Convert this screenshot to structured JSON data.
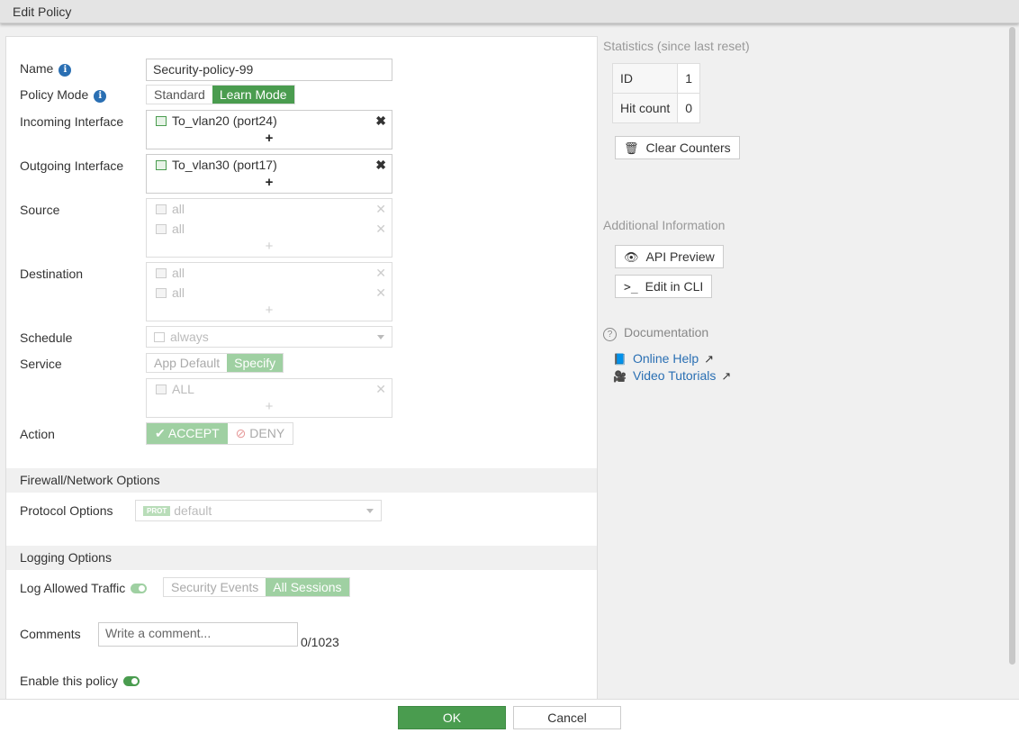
{
  "window": {
    "title": "Edit Policy"
  },
  "form": {
    "name": {
      "label": "Name",
      "value": "Security-policy-99"
    },
    "policy_mode": {
      "label": "Policy Mode",
      "options": [
        "Standard",
        "Learn Mode"
      ],
      "selected": "Learn Mode"
    },
    "incoming": {
      "label": "Incoming Interface",
      "entries": [
        "To_vlan20 (port24)"
      ],
      "add": "+",
      "remove": "✖"
    },
    "outgoing": {
      "label": "Outgoing Interface",
      "entries": [
        "To_vlan30 (port17)"
      ],
      "add": "+",
      "remove": "✖"
    },
    "source": {
      "label": "Source",
      "entries": [
        "all",
        "all"
      ],
      "add": "+",
      "remove": "✕"
    },
    "destination": {
      "label": "Destination",
      "entries": [
        "all",
        "all"
      ],
      "add": "+",
      "remove": "✕"
    },
    "schedule": {
      "label": "Schedule",
      "value": "always"
    },
    "service": {
      "label": "Service",
      "options": [
        "App Default",
        "Specify"
      ],
      "selected": "Specify",
      "entries": [
        "ALL"
      ],
      "add": "+",
      "remove": "✕"
    },
    "action": {
      "label": "Action",
      "accept": "ACCEPT",
      "deny": "DENY",
      "selected": "ACCEPT"
    }
  },
  "firewall_section": {
    "title": "Firewall/Network Options",
    "protocol_options": {
      "label": "Protocol Options",
      "badge": "PROT",
      "value": "default"
    }
  },
  "logging_section": {
    "title": "Logging Options",
    "log_allowed": {
      "label": "Log Allowed Traffic",
      "enabled": true,
      "options": [
        "Security Events",
        "All Sessions"
      ],
      "selected": "All Sessions"
    },
    "comments": {
      "label": "Comments",
      "placeholder": "Write a comment...",
      "counter": "0/1023"
    },
    "enable_policy": {
      "label": "Enable this policy",
      "enabled": true
    }
  },
  "sidebar": {
    "statistics": {
      "title": "Statistics (since last reset)",
      "rows": [
        {
          "key": "ID",
          "value": "1"
        },
        {
          "key": "Hit count",
          "value": "0"
        }
      ],
      "clear_button": "Clear Counters"
    },
    "additional": {
      "title": "Additional Information",
      "api_preview": "API Preview",
      "edit_cli": "Edit in CLI"
    },
    "documentation": {
      "title": "Documentation",
      "links": [
        "Online Help",
        "Video Tutorials"
      ]
    }
  },
  "footer": {
    "ok": "OK",
    "cancel": "Cancel"
  },
  "colors": {
    "accent": "#4a9c4f",
    "accent_light": "#9fd0a2",
    "link": "#2a6fb3"
  }
}
